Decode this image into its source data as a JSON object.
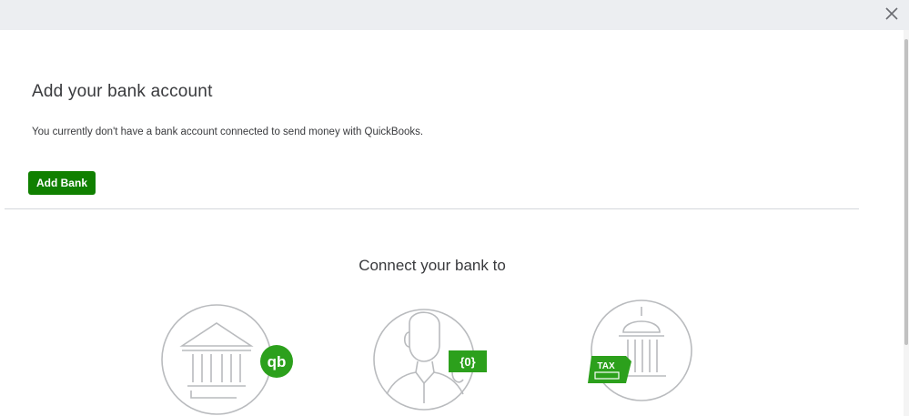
{
  "window": {
    "close_icon": "close-icon"
  },
  "main": {
    "title": "Add your bank account",
    "description": "You currently don't have a bank account connected to send money with QuickBooks.",
    "add_bank_label": "Add Bank",
    "accent_color": "#108000"
  },
  "connect": {
    "heading": "Connect your bank to",
    "illustrations": [
      {
        "icon": "bank-quickbooks-icon"
      },
      {
        "icon": "person-money-icon"
      },
      {
        "icon": "tax-government-icon",
        "badge": "TAX"
      }
    ]
  }
}
